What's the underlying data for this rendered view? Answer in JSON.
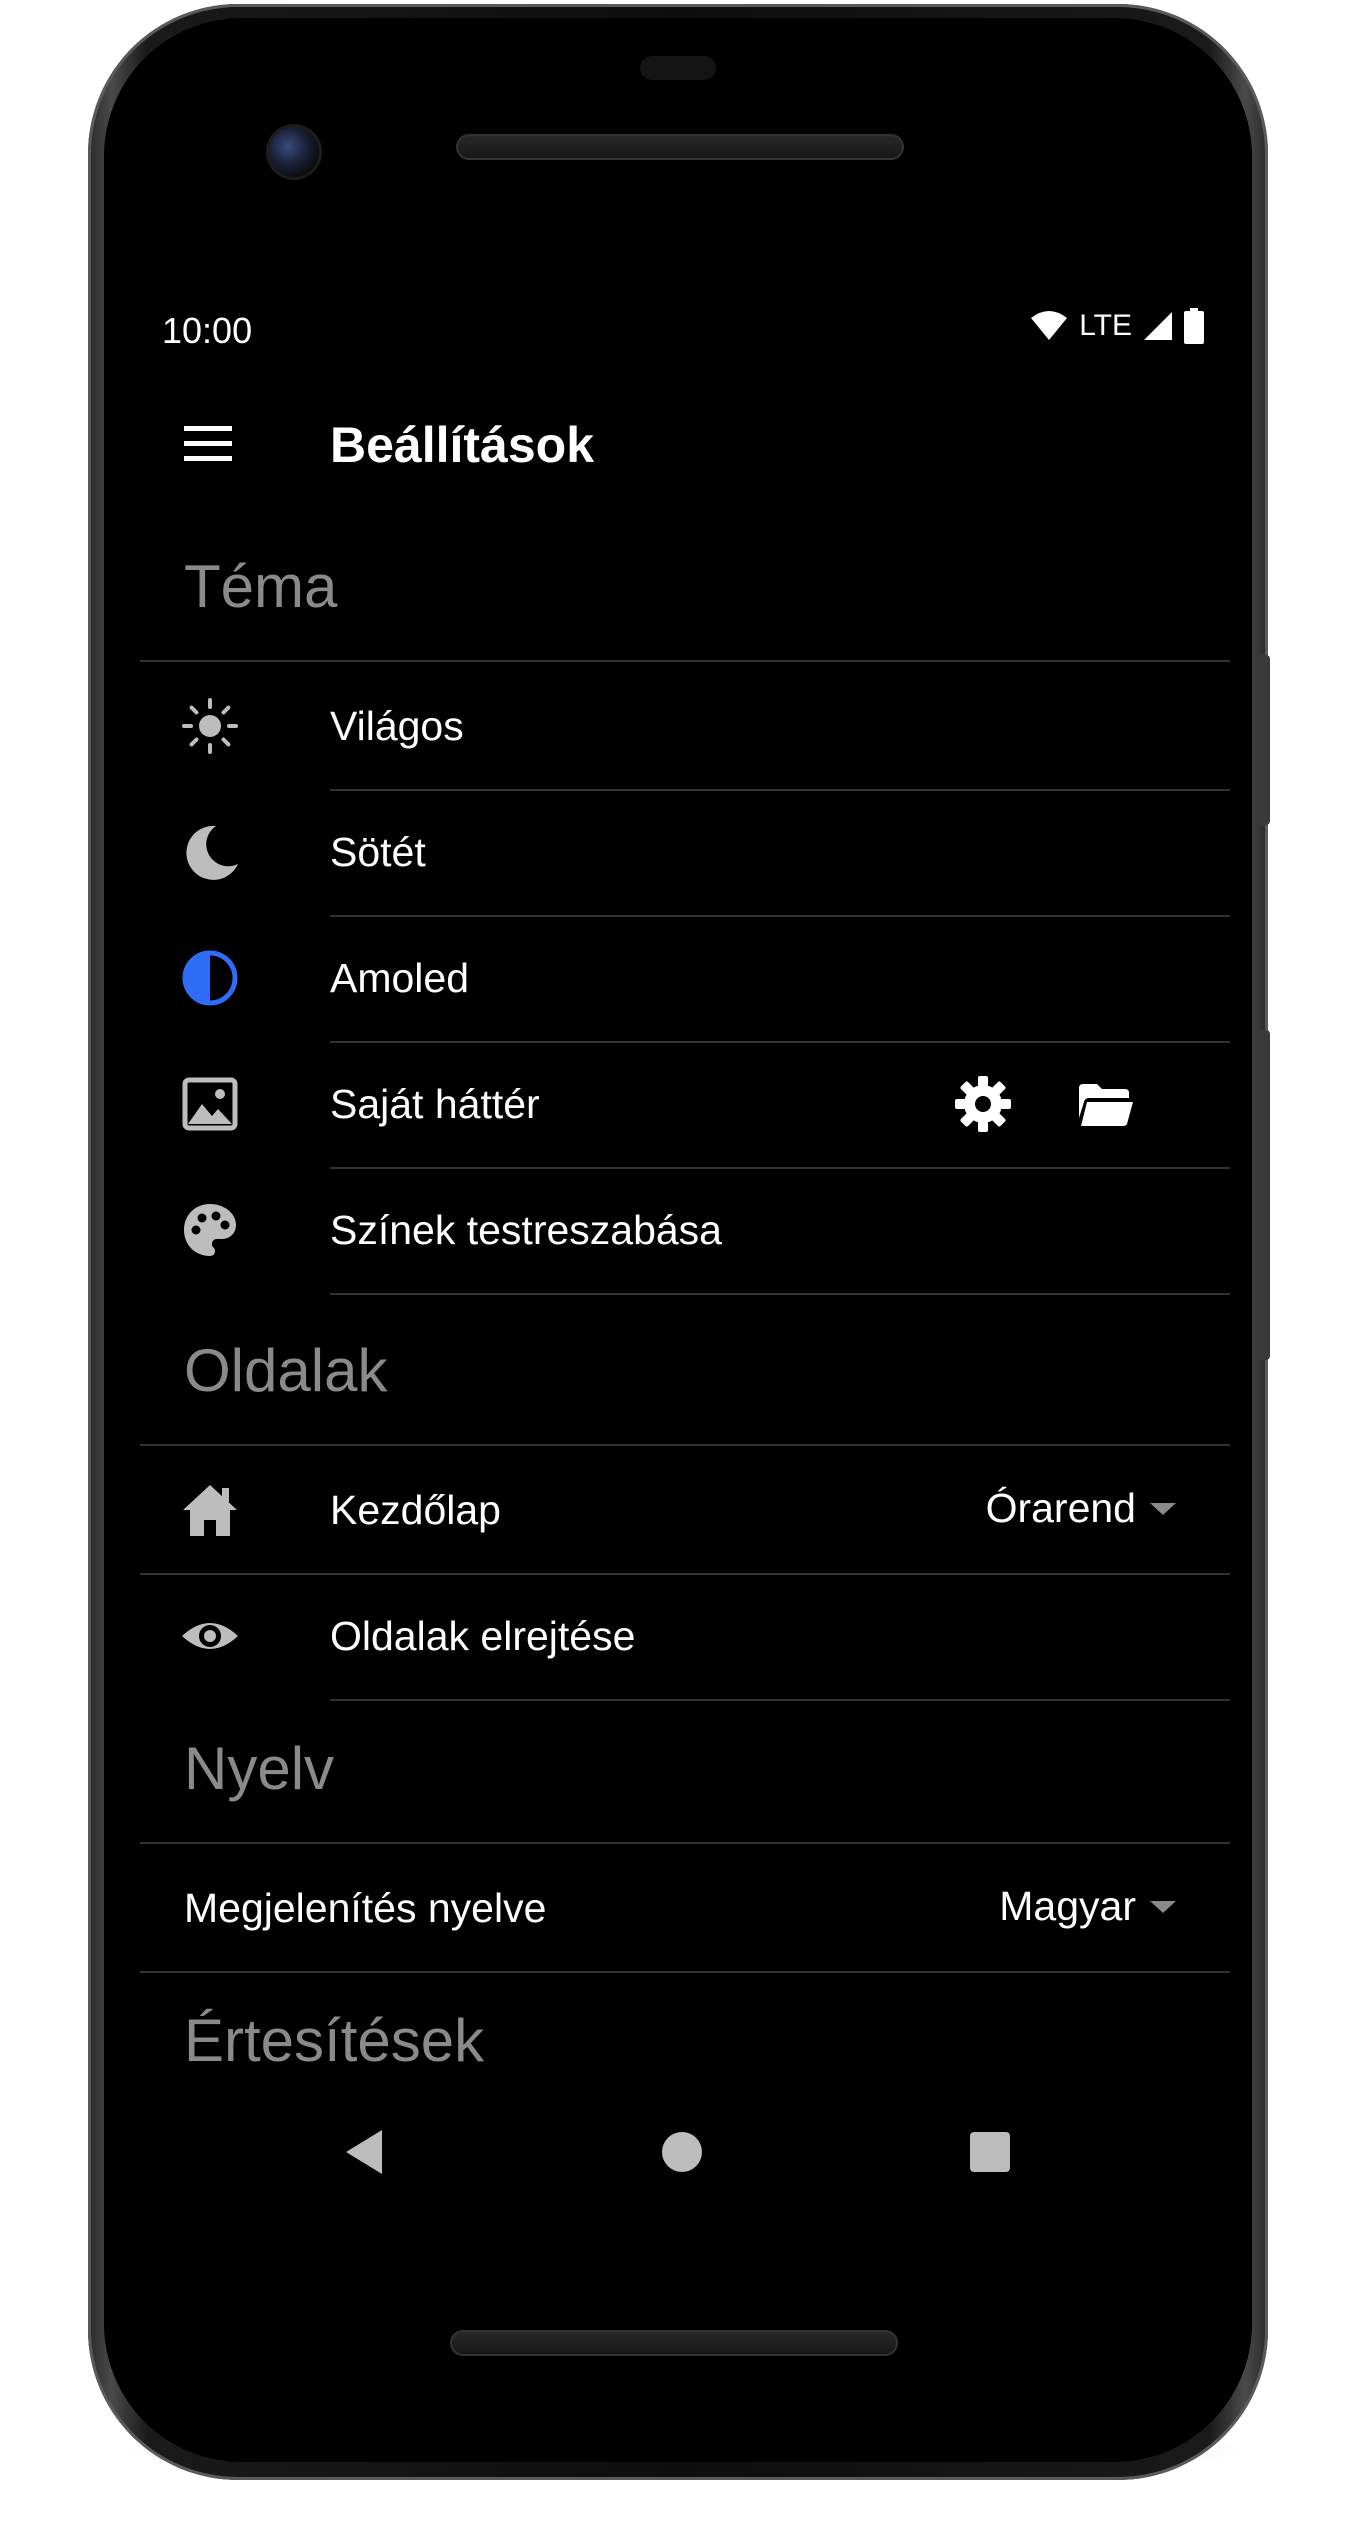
{
  "status_bar": {
    "time": "10:00",
    "network": "LTE"
  },
  "app_bar": {
    "title": "Beállítások"
  },
  "sections": {
    "theme": {
      "header": "Téma",
      "items": [
        {
          "label": "Világos",
          "icon": "sun-icon"
        },
        {
          "label": "Sötét",
          "icon": "moon-icon"
        },
        {
          "label": "Amoled",
          "icon": "contrast-icon"
        },
        {
          "label": "Saját háttér",
          "icon": "image-icon"
        },
        {
          "label": "Színek testreszabása",
          "icon": "palette-icon"
        }
      ]
    },
    "pages": {
      "header": "Oldalak",
      "items": [
        {
          "label": "Kezdőlap",
          "icon": "home-icon",
          "value": "Órarend"
        },
        {
          "label": "Oldalak elrejtése",
          "icon": "eye-icon"
        }
      ]
    },
    "language": {
      "header": "Nyelv",
      "items": [
        {
          "label": "Megjelenítés nyelve",
          "value": "Magyar"
        }
      ]
    },
    "notifications": {
      "header": "Értesítések"
    }
  },
  "colors": {
    "accent": "#2f6df6",
    "icon_gray": "#bdbdbd",
    "header_gray": "#8a8a8a",
    "divider": "#333333",
    "background": "#000000"
  }
}
